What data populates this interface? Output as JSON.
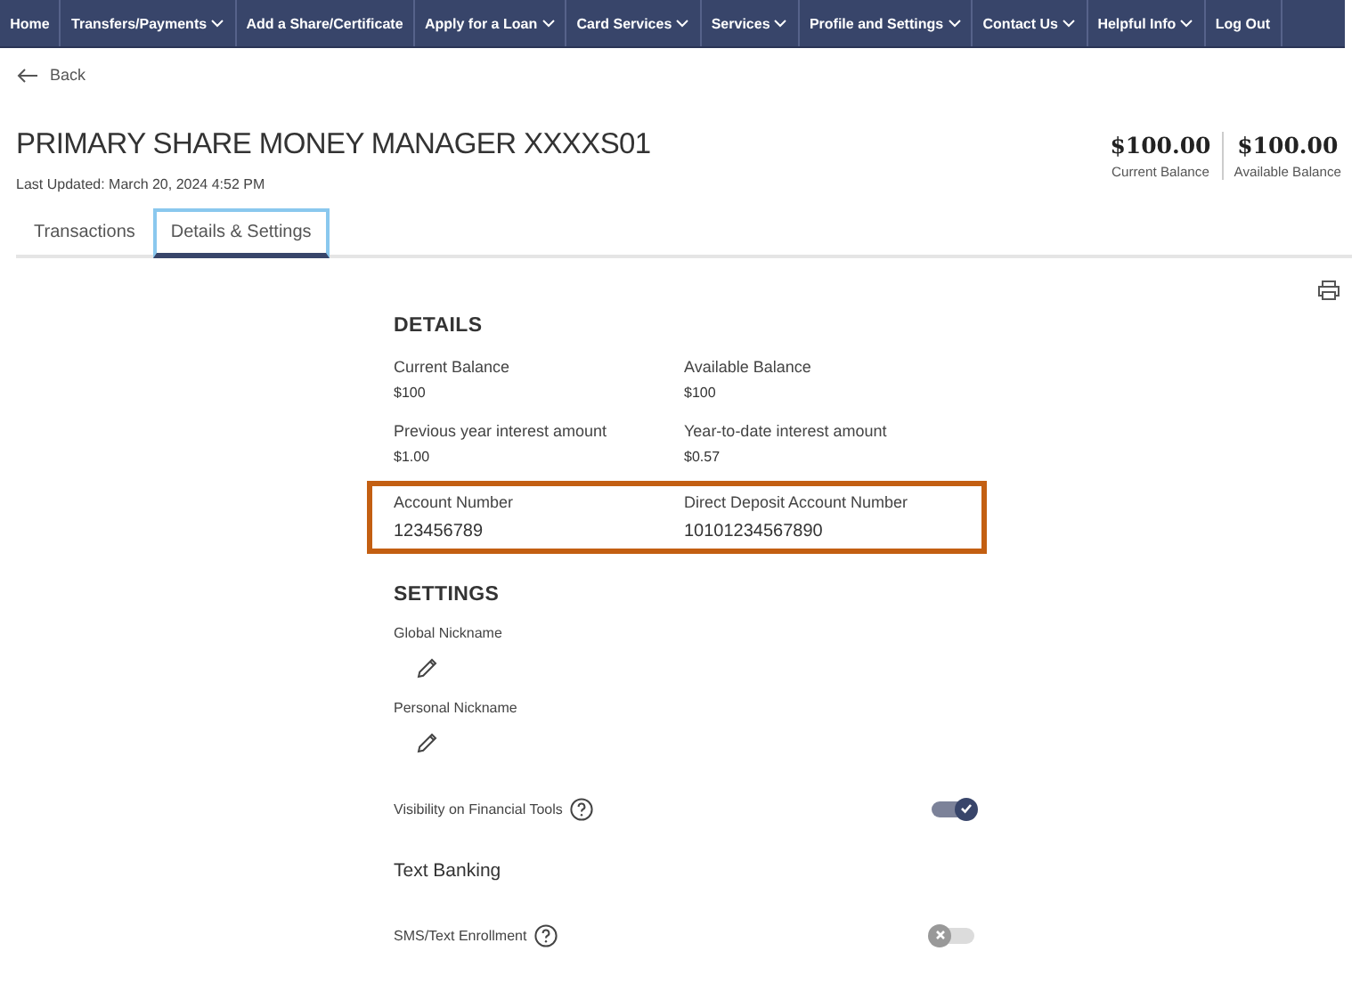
{
  "nav": [
    {
      "label": "Home",
      "dropdown": false
    },
    {
      "label": "Transfers/Payments",
      "dropdown": true
    },
    {
      "label": "Add a Share/Certificate",
      "dropdown": false
    },
    {
      "label": "Apply for a Loan",
      "dropdown": true
    },
    {
      "label": "Card Services",
      "dropdown": true
    },
    {
      "label": "Services",
      "dropdown": true
    },
    {
      "label": "Profile and Settings",
      "dropdown": true
    },
    {
      "label": "Contact Us",
      "dropdown": true
    },
    {
      "label": "Helpful Info",
      "dropdown": true
    },
    {
      "label": "Log Out",
      "dropdown": false
    }
  ],
  "back": "Back",
  "account": {
    "title": "PRIMARY SHARE MONEY MANAGER XXXXS01",
    "updated": "Last Updated: March 20, 2024 4:52 PM",
    "balances": [
      {
        "amount": "$100.00",
        "label": "Current Balance"
      },
      {
        "amount": "$100.00",
        "label": "Available Balance"
      }
    ]
  },
  "tabs": [
    {
      "label": "Transactions",
      "selected": false
    },
    {
      "label": "Details & Settings",
      "selected": true
    }
  ],
  "details": {
    "heading": "DETAILS",
    "rows": [
      {
        "highlighted": false,
        "fields": [
          {
            "label": "Current Balance",
            "value": "$100"
          },
          {
            "label": "Available Balance",
            "value": "$100"
          }
        ]
      },
      {
        "highlighted": false,
        "fields": [
          {
            "label": "Previous year interest amount",
            "value": "$1.00"
          },
          {
            "label": "Year-to-date interest amount",
            "value": "$0.57"
          }
        ]
      },
      {
        "highlighted": true,
        "fields": [
          {
            "label": "Account Number",
            "value": "123456789"
          },
          {
            "label": "Direct Deposit Account Number",
            "value": "10101234567890"
          }
        ]
      }
    ]
  },
  "settings": {
    "heading": "SETTINGS",
    "items": [
      {
        "kind": "nickname",
        "label": "Global Nickname"
      },
      {
        "kind": "nickname",
        "label": "Personal Nickname"
      },
      {
        "kind": "toggle",
        "label": "Visibility on Financial Tools",
        "on": true
      },
      {
        "kind": "subheading",
        "label": "Text Banking"
      },
      {
        "kind": "toggle",
        "label": "SMS/Text Enrollment",
        "on": false
      }
    ]
  }
}
